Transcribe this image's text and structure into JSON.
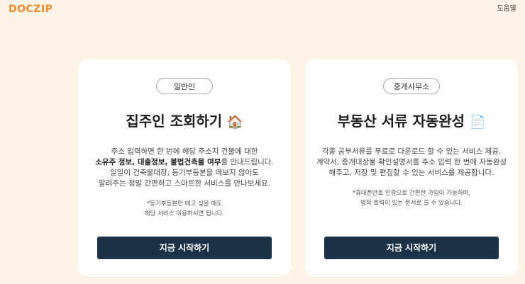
{
  "header": {
    "logo_text": "DOCZIP",
    "help_label": "도움말"
  },
  "cards": [
    {
      "badge": "일반인",
      "title": "집주인 조회하기",
      "emoji": "🏠",
      "desc_line1": "주소 입력하면 한 번에 해당 주소지 건물에 대한",
      "desc_line2_bold": "소유주 정보, 대출정보, 불법건축물 여부",
      "desc_line2_rest": "를 안내드립니다.",
      "desc_line3": "일일이 건축물대장, 등기부등본을 떼보지 않아도",
      "desc_line4": "알려주는 정말 간편하고 스마트한 서비스를 만나보세요.",
      "note_line1": "*등기부등본만 떼고 싶을 때도",
      "note_line2": "해당 서비스 이용하시면 됩니다.",
      "cta_label": "지금 시작하기"
    },
    {
      "badge": "중개사무소",
      "title": "부동산 서류 자동완성",
      "emoji": "📄",
      "desc_line1": "각종 공부서류를 무료로 다운로드 할 수 있는 서비스 제공.",
      "desc_line2": "계약서, 중개대상물 확인설명서를 주소 입력 한 번에 자동완성",
      "desc_line3": "해주고, 저장 및 편집할 수 있는 서비스를 제공합니다.",
      "note_line1": "*휴대폰번호 인증으로 간편한 가입이 가능하며,",
      "note_line2": "법적 효력이 있는 문서로 쓸 수 있습니다.",
      "cta_label": "지금 시작하기"
    }
  ],
  "colors": {
    "background": "#fdf3e7",
    "brand": "#f0892a",
    "cta": "#1c3248"
  }
}
